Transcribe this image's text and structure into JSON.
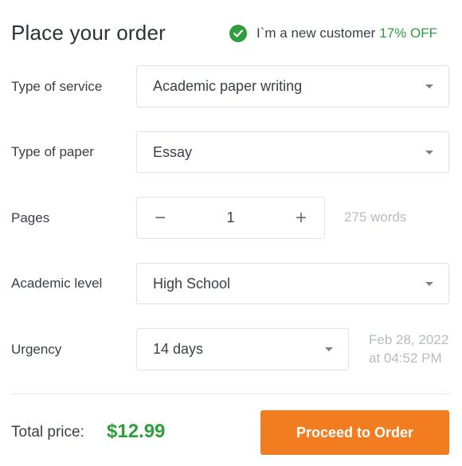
{
  "header": {
    "title": "Place your order",
    "new_customer_text": "I`m a new customer",
    "discount_text": "17% OFF",
    "check_icon": "check-circle-icon"
  },
  "form": {
    "service": {
      "label": "Type of service",
      "value": "Academic paper writing"
    },
    "paper": {
      "label": "Type of paper",
      "value": "Essay"
    },
    "pages": {
      "label": "Pages",
      "value": "1",
      "words": "275 words",
      "minus": "−",
      "plus": "+"
    },
    "level": {
      "label": "Academic level",
      "value": "High School"
    },
    "urgency": {
      "label": "Urgency",
      "value": "14 days",
      "deadline_date": "Feb 28, 2022",
      "deadline_time": "at 04:52 PM"
    }
  },
  "footer": {
    "total_label": "Total price:",
    "total_value": "$12.99",
    "proceed_label": "Proceed to Order"
  },
  "colors": {
    "accent_green": "#2e9d3b",
    "cta_orange": "#f27c20"
  }
}
